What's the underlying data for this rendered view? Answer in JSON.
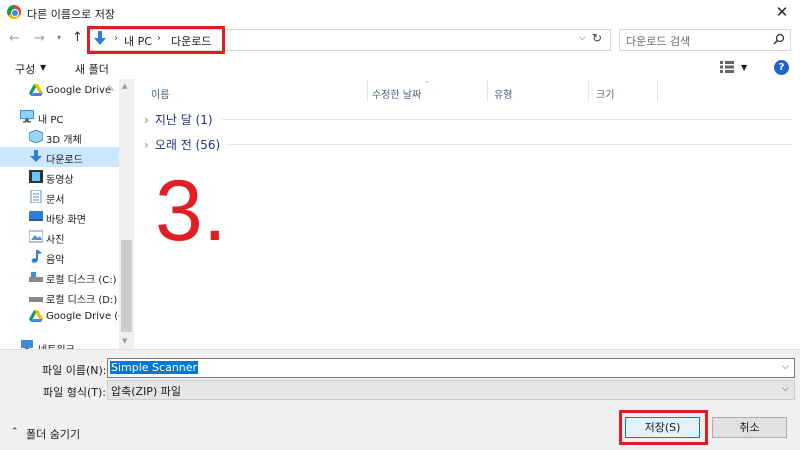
{
  "window": {
    "title": "다른 이름으로 저장",
    "close_glyph": "✕"
  },
  "address": {
    "breadcrumbs": [
      "내 PC",
      "다운로드"
    ],
    "search_placeholder": "다운로드 검색"
  },
  "toolbar": {
    "organize_label": "구성",
    "new_folder_label": "새 폴더",
    "help_label": "?"
  },
  "nav": {
    "items": [
      {
        "label": "Google Drive",
        "icon": "google-drive-icon",
        "pinned": true
      },
      {
        "label": "내 PC",
        "icon": "computer-icon"
      },
      {
        "label": "3D 개체",
        "icon": "3d-objects-icon"
      },
      {
        "label": "다운로드",
        "icon": "download-icon",
        "selected": true
      },
      {
        "label": "동영상",
        "icon": "video-icon"
      },
      {
        "label": "문서",
        "icon": "document-icon"
      },
      {
        "label": "바탕 화면",
        "icon": "desktop-icon"
      },
      {
        "label": "사진",
        "icon": "pictures-icon"
      },
      {
        "label": "음악",
        "icon": "music-icon"
      },
      {
        "label": "로컬 디스크 (C:)",
        "icon": "drive-icon"
      },
      {
        "label": "로컬 디스크 (D:)",
        "icon": "drive-icon"
      },
      {
        "label": "Google Drive (G:)",
        "icon": "google-drive-icon"
      },
      {
        "label": "네트워크",
        "icon": "network-icon"
      }
    ]
  },
  "columns": [
    "이름",
    "수정한 날짜",
    "유형",
    "크기"
  ],
  "groups": [
    {
      "label": "지난 달 (1)"
    },
    {
      "label": "오래 전 (56)"
    }
  ],
  "annotation": {
    "step_number": "3."
  },
  "form": {
    "filename_label": "파일 이름(N):",
    "filename_value": "Simple Scanner",
    "filetype_label": "파일 형식(T):",
    "filetype_value": "압축(ZIP) 파일",
    "hide_folders_label": "폴더 숨기기",
    "save_label": "저장(S)",
    "cancel_label": "취소"
  },
  "colors": {
    "highlight": "#e01e24",
    "accent": "#0078d7",
    "selection": "#cce8ff"
  }
}
